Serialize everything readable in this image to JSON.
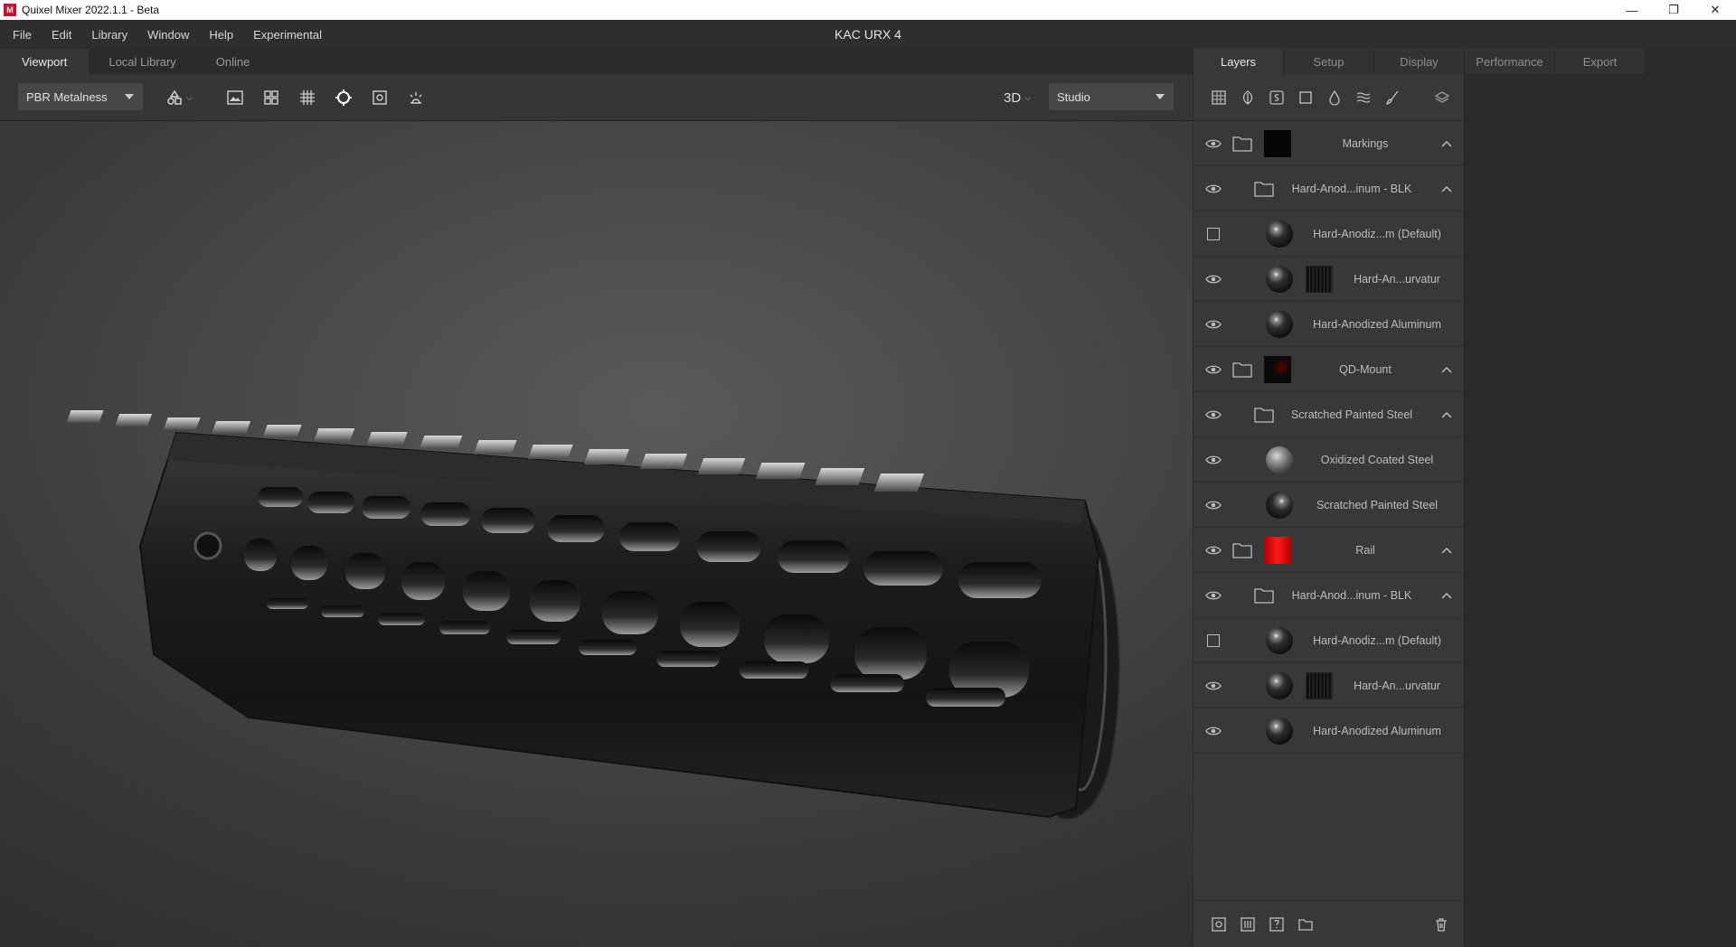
{
  "titlebar": {
    "app_title": "Quixel Mixer 2022.1.1 - Beta",
    "icon_letter": "M"
  },
  "menu": [
    "File",
    "Edit",
    "Library",
    "Window",
    "Help",
    "Experimental"
  ],
  "document_title": "KAC URX 4",
  "left_tabs": [
    "Viewport",
    "Local Library",
    "Online"
  ],
  "toolbar": {
    "shading_mode": "PBR Metalness",
    "view_mode": "3D",
    "environment": "Studio"
  },
  "right_tabs": [
    "Layers",
    "Setup",
    "Display",
    "Performance",
    "Export"
  ],
  "layers": [
    {
      "name": "Markings",
      "type": "group",
      "visibility": "eye",
      "thumb": "black",
      "indent": 0
    },
    {
      "name": "Hard-Anod...inum - BLK",
      "type": "folder",
      "visibility": "eye",
      "indent": 1
    },
    {
      "name": "Hard-Anodiz...m (Default)",
      "type": "material",
      "visibility": "checkbox",
      "sphere": "dark",
      "indent": 2
    },
    {
      "name": "Hard-An...urvatur",
      "type": "material-mask",
      "visibility": "eye",
      "sphere": "dark",
      "indent": 2
    },
    {
      "name": "Hard-Anodized Aluminum",
      "type": "material",
      "visibility": "eye",
      "sphere": "dark",
      "indent": 2
    },
    {
      "name": "QD-Mount",
      "type": "group",
      "visibility": "eye",
      "thumb": "dark-red",
      "indent": 0
    },
    {
      "name": "Scratched Painted Steel",
      "type": "folder",
      "visibility": "eye",
      "indent": 1
    },
    {
      "name": "Oxidized Coated Steel",
      "type": "material",
      "visibility": "eye",
      "sphere": "oxid",
      "indent": 2
    },
    {
      "name": "Scratched Painted Steel",
      "type": "material",
      "visibility": "eye",
      "sphere": "scratch",
      "indent": 2
    },
    {
      "name": "Rail",
      "type": "group",
      "visibility": "eye",
      "thumb": "red",
      "indent": 0
    },
    {
      "name": "Hard-Anod...inum - BLK",
      "type": "folder",
      "visibility": "eye",
      "indent": 1
    },
    {
      "name": "Hard-Anodiz...m (Default)",
      "type": "material",
      "visibility": "checkbox",
      "sphere": "dark",
      "indent": 2
    },
    {
      "name": "Hard-An...urvatur",
      "type": "material-mask",
      "visibility": "eye",
      "sphere": "dark",
      "indent": 2
    },
    {
      "name": "Hard-Anodized Aluminum",
      "type": "material",
      "visibility": "eye",
      "sphere": "dark",
      "indent": 2
    }
  ],
  "colors": {
    "accent_red": "#e01010",
    "panel_bg": "#383838",
    "viewport_bg": "#4a4a4a"
  },
  "icons": {
    "toolbar": [
      "shape-icon",
      "image-icon",
      "grid-icon",
      "wireframe-grid-icon",
      "crosshair-icon",
      "frame-icon",
      "light-icon"
    ],
    "layer_toolbar": [
      "checker-icon",
      "leaf-icon",
      "smart-material-icon",
      "square-icon",
      "drop-icon",
      "waves-icon",
      "brush-icon",
      "layers-icon"
    ],
    "layer_footer": [
      "add-layer-icon",
      "add-mask-icon",
      "add-smart-icon",
      "add-folder-icon",
      "trash-icon"
    ]
  }
}
